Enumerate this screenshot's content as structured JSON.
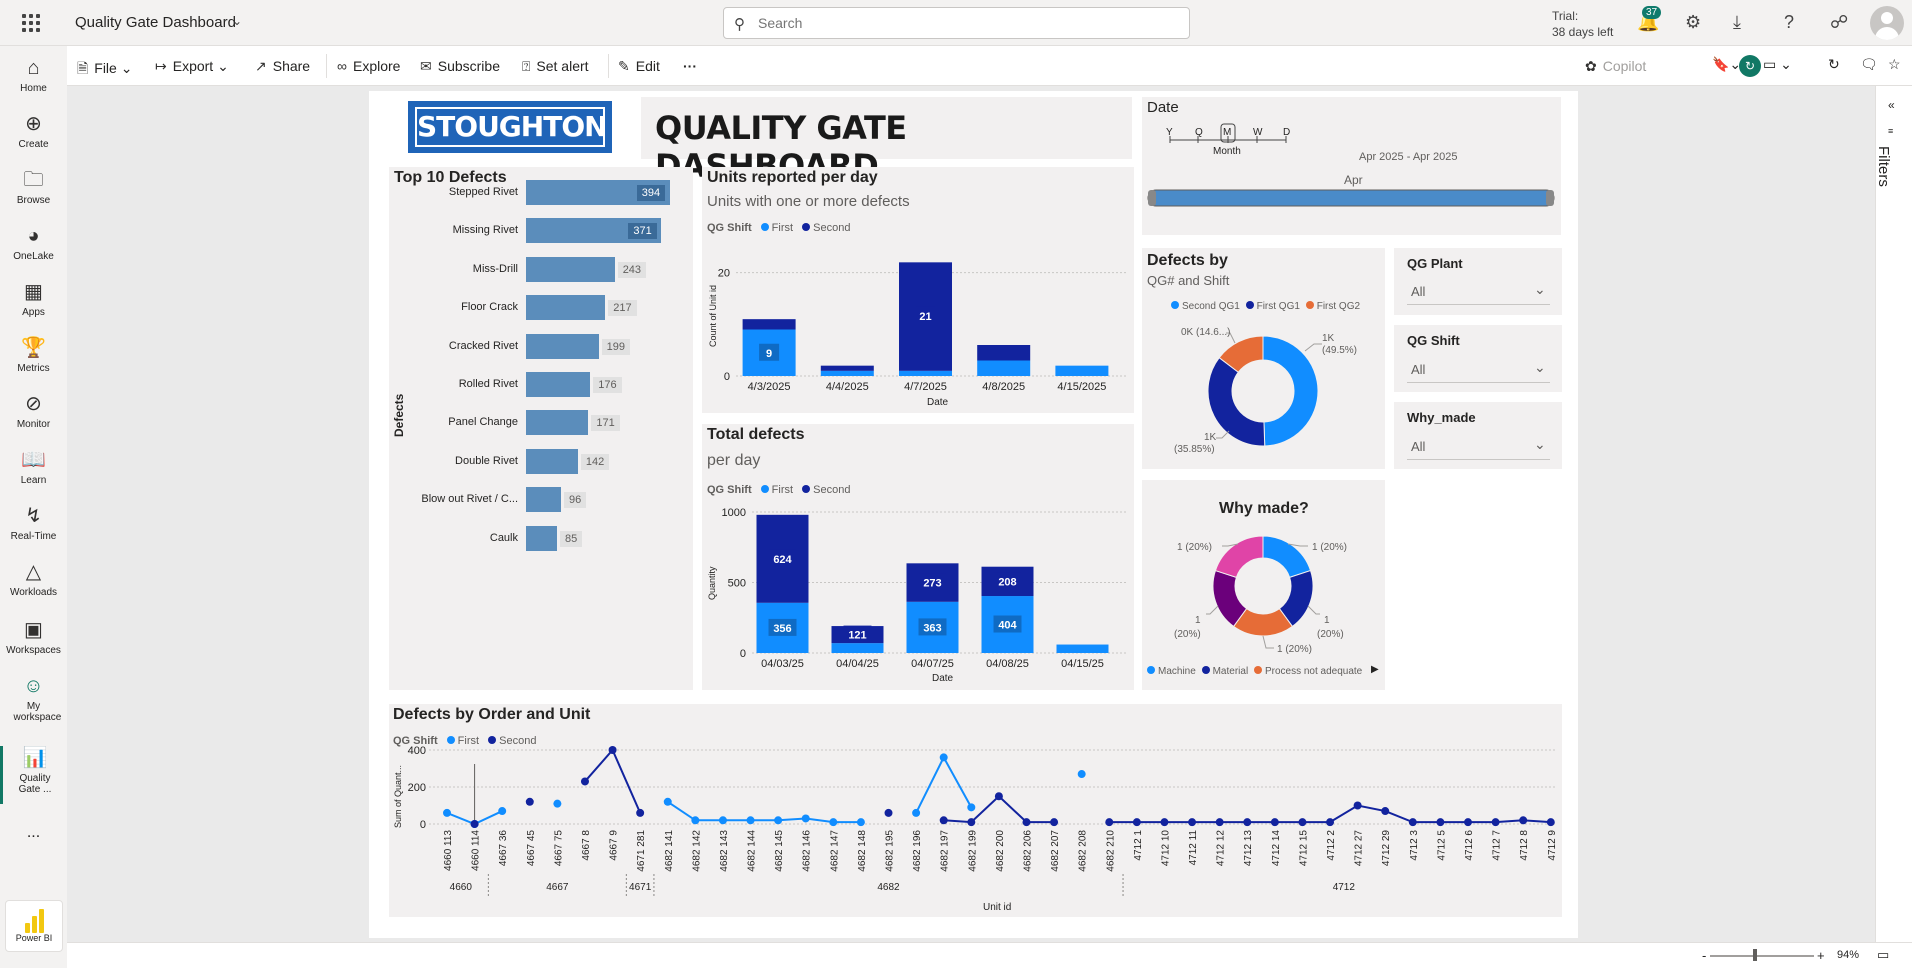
{
  "topbar": {
    "app_title": "Quality Gate Dashboard",
    "search_placeholder": "Search",
    "trial_line1": "Trial:",
    "trial_line2": "38 days left",
    "notification_count": "37"
  },
  "leftnav": {
    "items": [
      {
        "label": "Home",
        "icon": "home-icon"
      },
      {
        "label": "Create",
        "icon": "plus-circle-icon"
      },
      {
        "label": "Browse",
        "icon": "folder-icon"
      },
      {
        "label": "OneLake",
        "icon": "onelake-icon"
      },
      {
        "label": "Apps",
        "icon": "apps-icon"
      },
      {
        "label": "Metrics",
        "icon": "trophy-icon"
      },
      {
        "label": "Monitor",
        "icon": "monitor-icon"
      },
      {
        "label": "Learn",
        "icon": "book-icon"
      },
      {
        "label": "Real-Time",
        "icon": "lightning-icon"
      },
      {
        "label": "Workloads",
        "icon": "workloads-icon"
      },
      {
        "label": "Workspaces",
        "icon": "workspaces-icon"
      },
      {
        "label": "My workspace",
        "icon": "person-icon"
      },
      {
        "label": "Quality Gate ...",
        "icon": "report-icon"
      }
    ],
    "more": "...",
    "brand": "Power BI"
  },
  "toolbar": {
    "file": "File",
    "export": "Export",
    "share": "Share",
    "explore": "Explore",
    "subscribe": "Subscribe",
    "set_alert": "Set alert",
    "edit": "Edit",
    "more": "···",
    "copilot": "Copilot"
  },
  "header": {
    "logo_text": "STOUGHTON",
    "dashboard_title": "QUALITY GATE DASHBOARD"
  },
  "date_slicer": {
    "title": "Date",
    "levels": [
      "Y",
      "Q",
      "M",
      "W",
      "D"
    ],
    "selected_level": "Month",
    "range": "Apr 2025 - Apr 2025",
    "period": "Apr"
  },
  "top10": {
    "title": "Top 10 Defects",
    "axis_label": "Defects",
    "chart_data": {
      "type": "bar",
      "orientation": "horizontal",
      "categories": [
        "Stepped Rivet",
        "Missing Rivet",
        "Miss-Drill",
        "Floor Crack",
        "Cracked Rivet",
        "Rolled Rivet",
        "Panel Change",
        "Double Rivet",
        "Blow out Rivet / C...",
        "Caulk"
      ],
      "values": [
        394,
        371,
        243,
        217,
        199,
        176,
        171,
        142,
        96,
        85
      ]
    }
  },
  "units_per_day": {
    "title": "Units reported per day",
    "subtitle": "Units with one or more defects",
    "legend_title": "QG Shift",
    "ylabel": "Count of Unit id",
    "xlabel": "Date",
    "y_ticks": [
      "20",
      "0"
    ],
    "chart_data": {
      "type": "bar",
      "stacked": true,
      "categories": [
        "4/3/2025",
        "4/4/2025",
        "4/7/2025",
        "4/8/2025",
        "4/15/2025"
      ],
      "series": [
        {
          "name": "First",
          "color": "#118dff",
          "values": [
            9,
            1,
            1,
            3,
            2
          ]
        },
        {
          "name": "Second",
          "color": "#12239e",
          "values": [
            2,
            1,
            21,
            3,
            0
          ]
        }
      ],
      "data_labels": [
        "9",
        "",
        "21",
        "",
        ""
      ],
      "ylim": [
        0,
        24
      ]
    }
  },
  "total_defects": {
    "title": "Total defects",
    "subtitle": "per day",
    "legend_title": "QG Shift",
    "ylabel": "Quantity",
    "xlabel": "Date",
    "y_ticks": [
      "1000",
      "500",
      "0"
    ],
    "chart_data": {
      "type": "bar",
      "stacked": true,
      "categories": [
        "04/03/25",
        "04/04/25",
        "04/07/25",
        "04/08/25",
        "04/15/25"
      ],
      "series": [
        {
          "name": "First",
          "color": "#118dff",
          "values": [
            356,
            70,
            363,
            404,
            60
          ]
        },
        {
          "name": "Second",
          "color": "#12239e",
          "values": [
            624,
            121,
            273,
            208,
            0
          ]
        }
      ],
      "first_labels": [
        "356",
        "",
        "363",
        "404",
        ""
      ],
      "second_labels": [
        "624",
        "121",
        "273",
        "208",
        ""
      ],
      "ylim": [
        0,
        1000
      ]
    }
  },
  "defects_by": {
    "title": "Defects by",
    "subtitle": "QG# and Shift",
    "chart_data": {
      "type": "pie",
      "donut": true,
      "series": [
        {
          "name": "Second QG1",
          "color": "#118dff",
          "label": "1K (49.5%)"
        },
        {
          "name": "First QG1",
          "color": "#12239e",
          "label": "1K (35.85%)"
        },
        {
          "name": "First QG2",
          "color": "#e66c37",
          "label": "0K (14.6...)"
        }
      ],
      "values": [
        49.5,
        35.85,
        14.65
      ]
    },
    "labels": {
      "right_1": "1K",
      "right_2": "(49.5%)",
      "left_1": "1K",
      "left_2": "(35.85%)",
      "top": "0K (14.6...)"
    }
  },
  "why_made": {
    "title": "Why made?",
    "chart_data": {
      "type": "pie",
      "donut": true,
      "slices": [
        {
          "name": "Machine",
          "color": "#118dff",
          "value": 1
        },
        {
          "name": "Material",
          "color": "#12239e",
          "value": 1
        },
        {
          "name": "Process not adequate",
          "color": "#e66c37",
          "value": 1
        },
        {
          "name": "",
          "color": "#6b007b",
          "value": 1
        },
        {
          "name": "",
          "color": "#e044a7",
          "value": 1
        }
      ]
    },
    "labels": {
      "top_left": "1 (20%)",
      "top_right": "1 (20%)",
      "right_1": "1",
      "right_2": "(20%)",
      "left_1": "1",
      "left_2": "(20%)",
      "bottom": "1 (20%)"
    },
    "legend": [
      "Machine",
      "Material",
      "Process not adequate"
    ]
  },
  "slicers": [
    {
      "title": "QG Plant",
      "value": "All"
    },
    {
      "title": "QG Shift",
      "value": "All"
    },
    {
      "title": "Why_made",
      "value": "All"
    }
  ],
  "defects_order": {
    "title": "Defects by Order and Unit",
    "legend_title": "QG Shift",
    "ylabel": "Sum of Quant...",
    "xlabel": "Unit id",
    "y_ticks": [
      "400",
      "200",
      "0"
    ],
    "groups": [
      "4660",
      "4667",
      "4671",
      "4682",
      "4712"
    ],
    "chart_data": {
      "type": "line",
      "ylim": [
        0,
        430
      ],
      "categories": [
        "4660 113",
        "4660 114",
        "4667 36",
        "4667 45",
        "4667 75",
        "4667 8",
        "4667 9",
        "4671 281",
        "4682 141",
        "4682 142",
        "4682 143",
        "4682 144",
        "4682 145",
        "4682 146",
        "4682 147",
        "4682 148",
        "4682 195",
        "4682 196",
        "4682 197",
        "4682 199",
        "4682 200",
        "4682 206",
        "4682 207",
        "4682 208",
        "4682 210",
        "4712 1",
        "4712 10",
        "4712 11",
        "4712 12",
        "4712 13",
        "4712 14",
        "4712 15",
        "4712 2",
        "4712 27",
        "4712 29",
        "4712 3",
        "4712 5",
        "4712 6",
        "4712 7",
        "4712 8",
        "4712 9"
      ],
      "series": [
        {
          "name": "First",
          "color": "#118dff",
          "values": [
            60,
            0,
            70,
            null,
            110,
            null,
            null,
            null,
            120,
            20,
            20,
            20,
            20,
            30,
            10,
            10,
            null,
            60,
            360,
            90,
            null,
            null,
            null,
            270,
            null,
            null,
            null,
            null,
            null,
            null,
            null,
            null,
            null,
            null,
            null,
            null,
            null,
            null,
            null,
            null,
            null
          ]
        },
        {
          "name": "Second",
          "color": "#12239e",
          "values": [
            null,
            0,
            null,
            120,
            null,
            230,
            400,
            60,
            null,
            null,
            null,
            null,
            null,
            null,
            null,
            null,
            60,
            null,
            20,
            10,
            150,
            10,
            10,
            null,
            10,
            10,
            10,
            10,
            10,
            10,
            10,
            10,
            10,
            100,
            70,
            10,
            10,
            10,
            10,
            20,
            10
          ]
        }
      ]
    }
  },
  "filters_label": "Filters",
  "statusbar": {
    "zoom": "94%",
    "minus": "-",
    "plus": "+"
  }
}
